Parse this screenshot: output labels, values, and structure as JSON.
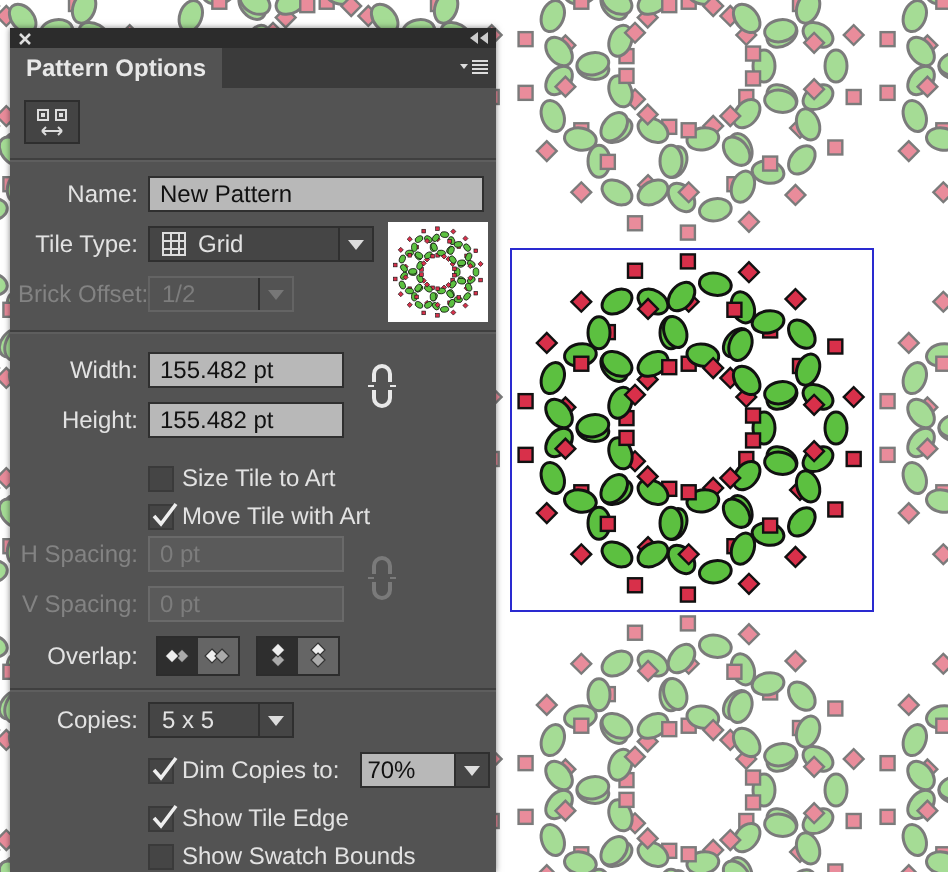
{
  "panel": {
    "tab": "Pattern Options"
  },
  "name": {
    "label": "Name:",
    "value": "New Pattern"
  },
  "tile_type": {
    "label": "Tile Type:",
    "value": "Grid"
  },
  "brick_offset": {
    "label": "Brick Offset:",
    "value": "1/2",
    "disabled": true
  },
  "width": {
    "label": "Width:",
    "value": "155.482 pt"
  },
  "height": {
    "label": "Height:",
    "value": "155.482 pt"
  },
  "size_tile_to_art": {
    "label": "Size Tile to Art",
    "checked": false
  },
  "move_tile_with_art": {
    "label": "Move Tile with Art",
    "checked": true
  },
  "h_spacing": {
    "label": "H Spacing:",
    "value": "0 pt",
    "disabled": true
  },
  "v_spacing": {
    "label": "V Spacing:",
    "value": "0 pt",
    "disabled": true
  },
  "overlap": {
    "label": "Overlap:",
    "horizontal": [
      {
        "selected": true
      },
      {
        "selected": false
      }
    ],
    "vertical": [
      {
        "selected": true
      },
      {
        "selected": false
      }
    ]
  },
  "copies": {
    "label": "Copies:",
    "value": "5 x 5"
  },
  "dim_copies": {
    "label": "Dim Copies to:",
    "checked": true,
    "value": "70%"
  },
  "show_tile_edge": {
    "label": "Show Tile Edge",
    "checked": true
  },
  "show_swatch_bounds": {
    "label": "Show Swatch Bounds",
    "checked": false
  }
}
